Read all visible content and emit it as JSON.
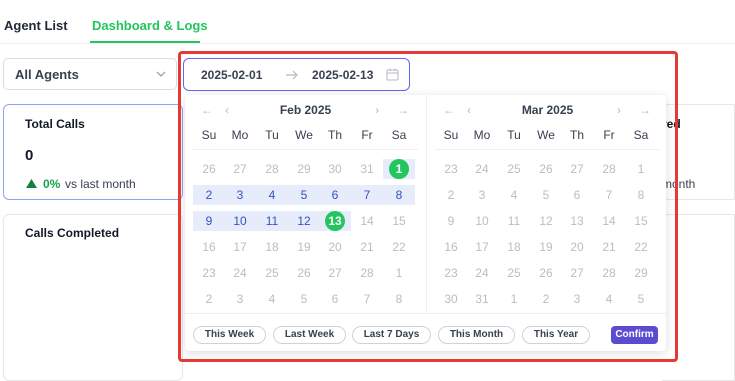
{
  "tabs": {
    "agent_list": "Agent List",
    "dashboard_logs": "Dashboard & Logs"
  },
  "agent_filter": {
    "value": "All Agents"
  },
  "date_range": {
    "start": "2025-02-01",
    "end": "2025-02-13"
  },
  "cards": {
    "total_calls": {
      "title": "Total Calls",
      "value": "0",
      "change": "0%",
      "comparison": "vs last month"
    },
    "calls_completed": {
      "title": "Calls Completed"
    },
    "partial_right": {
      "title_fragment": "red",
      "comparison_fragment": "month"
    }
  },
  "calendar": {
    "weekdays": [
      "Su",
      "Mo",
      "Tu",
      "We",
      "Th",
      "Fr",
      "Sa"
    ],
    "months": [
      {
        "title": "Feb 2025",
        "days": [
          [
            "26",
            "27",
            "28",
            "29",
            "30",
            "31",
            "1"
          ],
          [
            "2",
            "3",
            "4",
            "5",
            "6",
            "7",
            "8"
          ],
          [
            "9",
            "10",
            "11",
            "12",
            "13",
            "14",
            "15"
          ],
          [
            "16",
            "17",
            "18",
            "19",
            "20",
            "21",
            "22"
          ],
          [
            "23",
            "24",
            "25",
            "26",
            "27",
            "28",
            "1"
          ],
          [
            "2",
            "3",
            "4",
            "5",
            "6",
            "7",
            "8"
          ]
        ]
      },
      {
        "title": "Mar 2025",
        "days": [
          [
            "23",
            "24",
            "25",
            "26",
            "27",
            "28",
            "1"
          ],
          [
            "2",
            "3",
            "4",
            "5",
            "6",
            "7",
            "8"
          ],
          [
            "9",
            "10",
            "11",
            "12",
            "13",
            "14",
            "15"
          ],
          [
            "16",
            "17",
            "18",
            "19",
            "20",
            "21",
            "22"
          ],
          [
            "23",
            "24",
            "25",
            "26",
            "27",
            "28",
            "29"
          ],
          [
            "30",
            "31",
            "1",
            "2",
            "3",
            "4",
            "5"
          ]
        ]
      }
    ],
    "presets": [
      "This Week",
      "Last Week",
      "Last 7 Days",
      "This Month",
      "This Year"
    ],
    "confirm_label": "Confirm"
  },
  "colors": {
    "accent_green": "#22c55e",
    "accent_indigo": "#5b4ccf",
    "range_bg": "#e6ecfa",
    "highlight_red": "#e53935"
  },
  "icons": {
    "prev_year": "double-left-arrow-icon",
    "prev_month": "left-arrow-icon",
    "next_month": "right-arrow-icon",
    "next_year": "double-right-arrow-icon",
    "calendar": "calendar-icon",
    "trend_up": "triangle-up-icon"
  }
}
